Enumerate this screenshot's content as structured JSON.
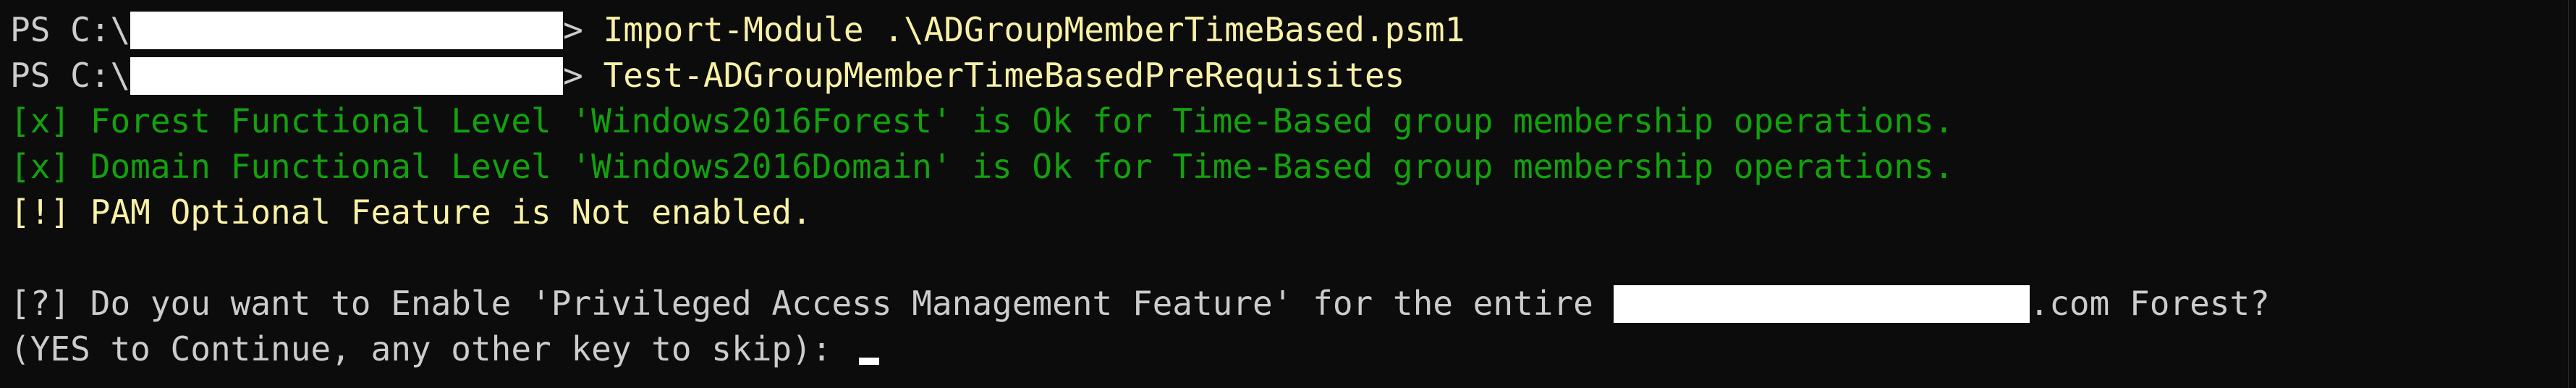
{
  "colors": {
    "background": "#0c0c0c",
    "text": "#cccccc",
    "command": "#f9f1a5",
    "success": "#13a10e",
    "redaction": "#ffffff"
  },
  "terminal": {
    "line1": {
      "prompt_prefix": "PS C:\\",
      "prompt_suffix": ">",
      "command": " Import-Module .\\ADGroupMemberTimeBased.psm1"
    },
    "line2": {
      "prompt_prefix": "PS C:\\",
      "prompt_suffix": ">",
      "command": " Test-ADGroupMemberTimeBasedPreRequisites"
    },
    "line3": "[x] Forest Functional Level 'Windows2016Forest' is Ok for Time-Based group membership operations.",
    "line4": "[x] Domain Functional Level 'Windows2016Domain' is Ok for Time-Based group membership operations.",
    "line5": "[!] PAM Optional Feature is Not enabled.",
    "line6": {
      "before": "[?] Do you want to Enable 'Privileged Access Management Feature' for the entire ",
      "after": ".com Forest?"
    },
    "line7": "(YES to Continue, any other key to skip): "
  }
}
